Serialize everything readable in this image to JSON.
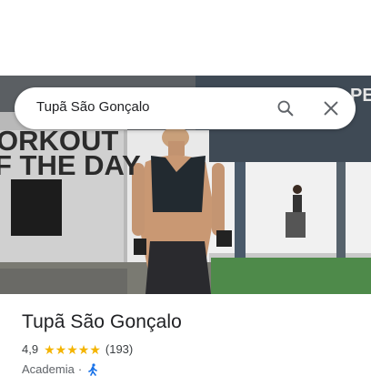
{
  "search": {
    "query": "Tupã São Gonçalo"
  },
  "hero": {
    "wall_text_line1": "ORKOUT",
    "wall_text_line2": "F THE DAY",
    "corner_text": "PE"
  },
  "place": {
    "name": "Tupã São Gonçalo",
    "rating": "4,9",
    "stars": 5,
    "review_count": "(193)",
    "category": "Academia",
    "separator": "·"
  },
  "icons": {
    "search": "search-icon",
    "close": "close-icon",
    "walk": "walking-person-icon",
    "star": "star-icon"
  },
  "colors": {
    "star": "#f4b400",
    "accessibility_blue": "#1a73e8",
    "text_primary": "#202124",
    "text_secondary": "#5f6368"
  }
}
